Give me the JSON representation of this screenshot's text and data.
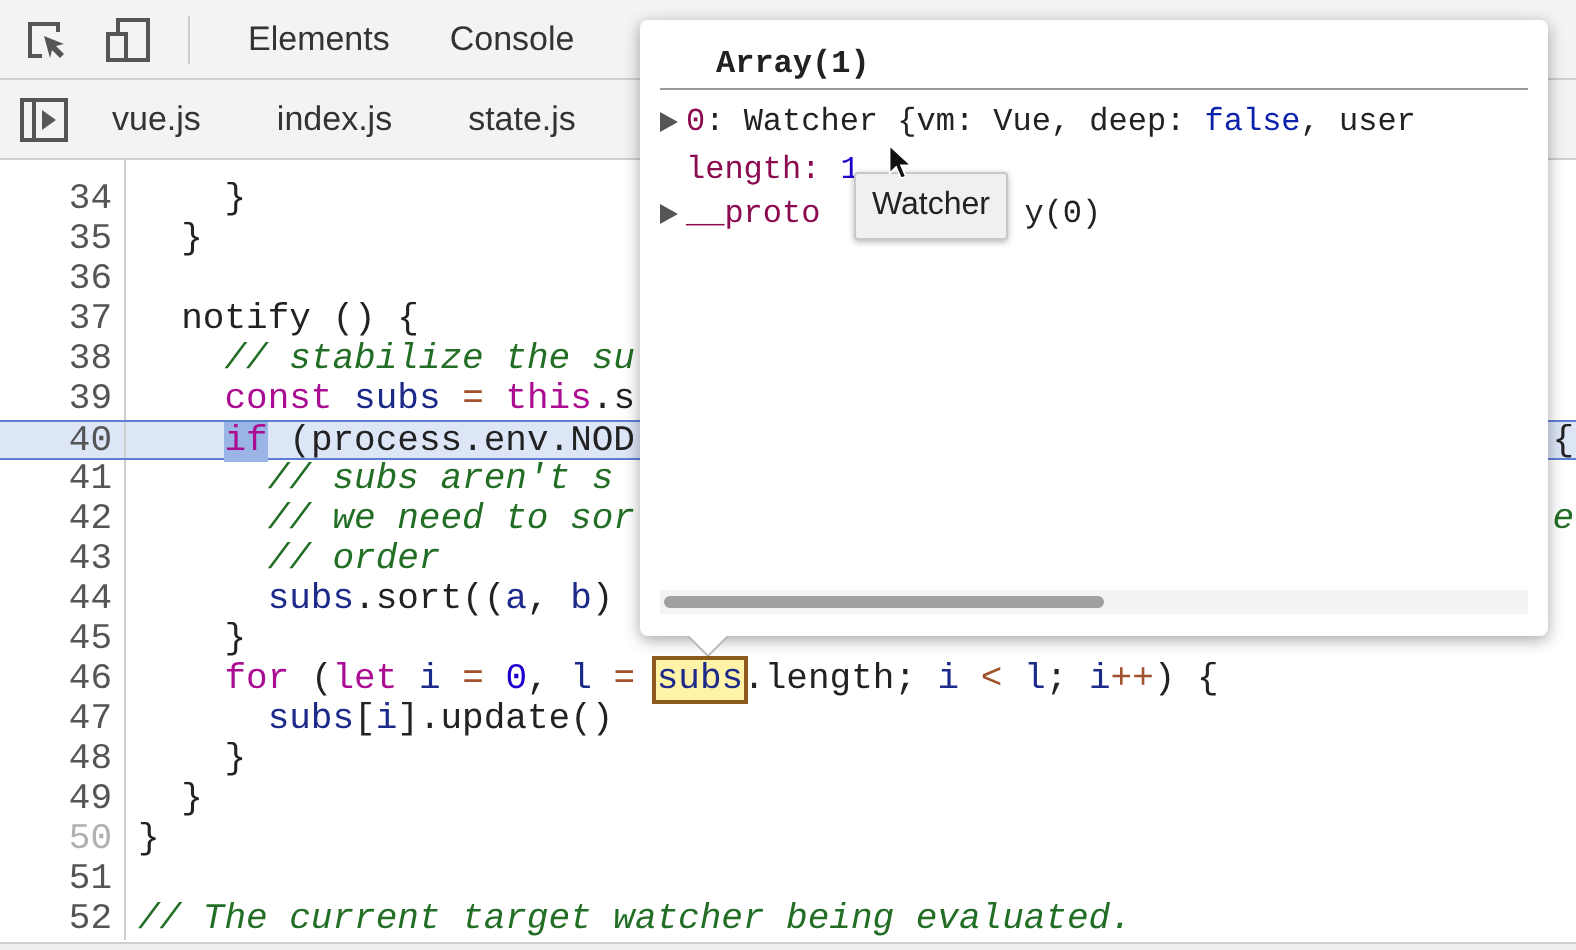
{
  "toolbar": {
    "tabs": [
      "Elements",
      "Console"
    ]
  },
  "file_tabs": [
    "vue.js",
    "index.js",
    "state.js"
  ],
  "code": {
    "lines": [
      {
        "number": "34",
        "current": false,
        "muted_number": false,
        "segments": [
          {
            "text": "    }",
            "kind": "plain"
          }
        ]
      },
      {
        "number": "35",
        "current": false,
        "muted_number": false,
        "segments": [
          {
            "text": "  }",
            "kind": "plain"
          }
        ]
      },
      {
        "number": "36",
        "current": false,
        "muted_number": false
      },
      {
        "number": "37",
        "current": false,
        "muted_number": false,
        "segments": [
          {
            "text": "  notify () {",
            "kind": "plain"
          }
        ]
      },
      {
        "number": "38",
        "current": false,
        "muted_number": false,
        "segments": [
          {
            "text": "    // stabilize the su",
            "kind": "comment"
          }
        ]
      },
      {
        "number": "39",
        "current": false,
        "muted_number": false,
        "segments": [
          {
            "text": "    const",
            "kind": "keyword"
          },
          {
            "text": " subs ",
            "kind": "variable"
          },
          {
            "text": "=",
            "kind": "operator"
          },
          {
            "text": " this",
            "kind": "keyword"
          },
          {
            "text": ".s",
            "kind": "plain"
          }
        ]
      },
      {
        "number": "40",
        "current": true,
        "muted_number": false,
        "segments": [
          {
            "text": "    if",
            "kind": "keyword",
            "selected": true
          },
          {
            "text": " (process.env.NOD",
            "kind": "plain"
          }
        ],
        "right": {
          "text": "{",
          "kind": "plain"
        }
      },
      {
        "number": "41",
        "current": false,
        "muted_number": false,
        "segments": [
          {
            "text": "      // subs aren't s",
            "kind": "comment"
          }
        ]
      },
      {
        "number": "42",
        "current": false,
        "muted_number": false,
        "segments": [
          {
            "text": "      // we need to sor",
            "kind": "comment"
          }
        ],
        "right": {
          "text": "e",
          "kind": "comment"
        }
      },
      {
        "number": "43",
        "current": false,
        "muted_number": false,
        "segments": [
          {
            "text": "      // order",
            "kind": "comment"
          }
        ]
      },
      {
        "number": "44",
        "current": false,
        "muted_number": false,
        "segments": [
          {
            "text": "      subs",
            "kind": "variable"
          },
          {
            "text": ".sort((",
            "kind": "plain"
          },
          {
            "text": "a",
            "kind": "variable"
          },
          {
            "text": ", ",
            "kind": "plain"
          },
          {
            "text": "b",
            "kind": "variable"
          },
          {
            "text": ")",
            "kind": "plain"
          }
        ]
      },
      {
        "number": "45",
        "current": false,
        "muted_number": false,
        "segments": [
          {
            "text": "    }",
            "kind": "plain"
          }
        ]
      },
      {
        "number": "46",
        "current": false,
        "muted_number": false,
        "segments": [
          {
            "text": "    for",
            "kind": "keyword"
          },
          {
            "text": " (",
            "kind": "plain"
          },
          {
            "text": "let",
            "kind": "keyword"
          },
          {
            "text": " i ",
            "kind": "variable"
          },
          {
            "text": "=",
            "kind": "operator"
          },
          {
            "text": " 0",
            "kind": "number"
          },
          {
            "text": ", ",
            "kind": "plain"
          },
          {
            "text": "l ",
            "kind": "variable"
          },
          {
            "text": "=",
            "kind": "operator"
          },
          {
            "text": " subs",
            "kind": "variable",
            "matched": true
          },
          {
            "text": ".length; ",
            "kind": "plain"
          },
          {
            "text": "i ",
            "kind": "variable"
          },
          {
            "text": "<",
            "kind": "operator"
          },
          {
            "text": " l",
            "kind": "variable"
          },
          {
            "text": "; ",
            "kind": "plain"
          },
          {
            "text": "i",
            "kind": "variable"
          },
          {
            "text": "++",
            "kind": "operator"
          },
          {
            "text": ") {",
            "kind": "plain"
          }
        ]
      },
      {
        "number": "47",
        "current": false,
        "muted_number": false,
        "segments": [
          {
            "text": "      subs",
            "kind": "variable"
          },
          {
            "text": "[",
            "kind": "plain"
          },
          {
            "text": "i",
            "kind": "variable"
          },
          {
            "text": "].update()",
            "kind": "plain"
          }
        ]
      },
      {
        "number": "48",
        "current": false,
        "muted_number": false,
        "segments": [
          {
            "text": "    }",
            "kind": "plain"
          }
        ]
      },
      {
        "number": "49",
        "current": false,
        "muted_number": false,
        "segments": [
          {
            "text": "  }",
            "kind": "plain"
          }
        ]
      },
      {
        "number": "50",
        "current": false,
        "muted_number": true,
        "segments": [
          {
            "text": "}",
            "kind": "plain"
          }
        ]
      },
      {
        "number": "51",
        "current": false,
        "muted_number": false
      },
      {
        "number": "52",
        "current": false,
        "muted_number": false,
        "segments": [
          {
            "text": "// The current target watcher being evaluated.",
            "kind": "comment"
          }
        ]
      }
    ]
  },
  "popover": {
    "title": "Array(1)",
    "item": {
      "key": "0",
      "sep": ":",
      "type": "Watcher",
      "preview": [
        {
          "text": " {vm: Vue, deep: ",
          "kind": "plain"
        },
        {
          "text": "false",
          "kind": "keyword_value"
        },
        {
          "text": ", user",
          "kind": "plain"
        }
      ]
    },
    "length": {
      "key": "length:",
      "value": "1"
    },
    "proto": {
      "before": "__proto",
      "after": "y(0)"
    },
    "tooltip": "Watcher"
  }
}
